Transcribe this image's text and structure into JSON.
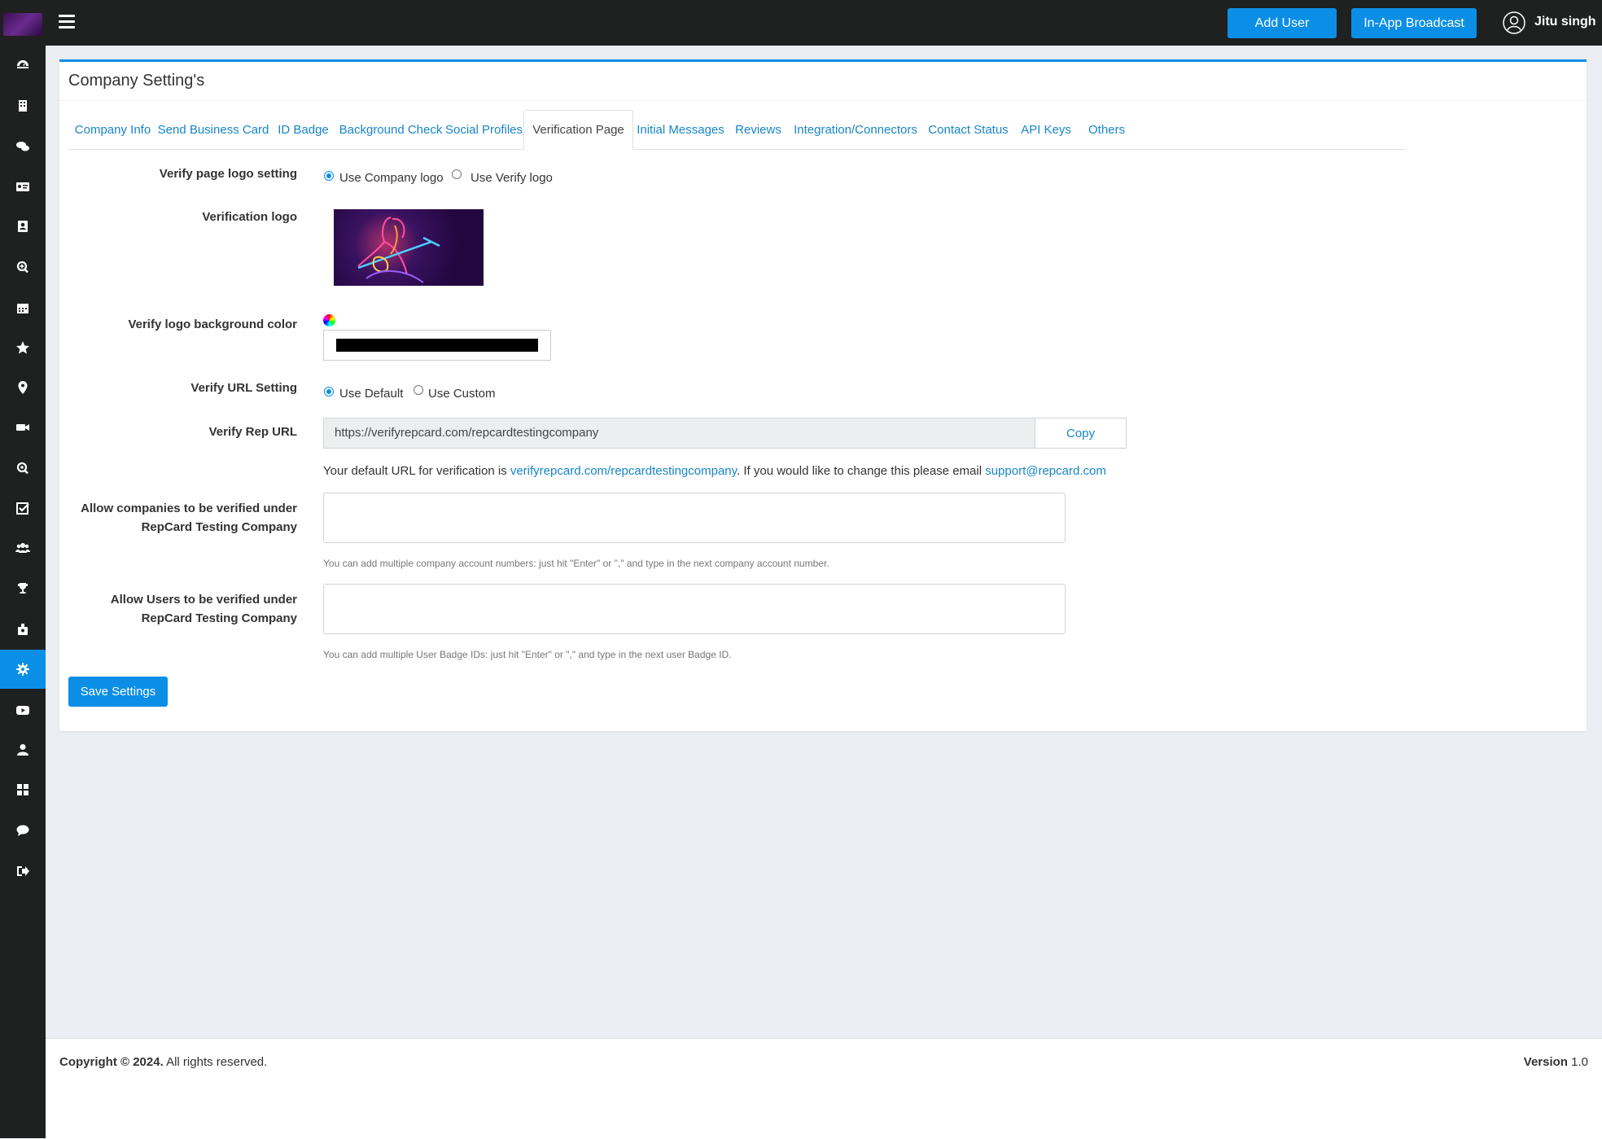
{
  "topbar": {
    "add_user_label": "Add User",
    "broadcast_label": "In-App Broadcast",
    "user_name": "Jitu singh"
  },
  "sidebar": {
    "icons": [
      "dashboard-icon",
      "building-icon",
      "chat-icon",
      "id-card-icon",
      "contact-book-icon",
      "search-plus-icon",
      "calendar-icon",
      "star-icon",
      "location-pin-icon",
      "video-icon",
      "search-icon",
      "checklist-icon",
      "users-icon",
      "trophy-icon",
      "badge-icon",
      "gear-icon",
      "youtube-icon",
      "user-icon",
      "grid-icon",
      "comment-icon",
      "logout-icon"
    ],
    "active": "gear-icon"
  },
  "panel": {
    "title": "Company Setting's",
    "tabs": [
      {
        "label": "Company Info"
      },
      {
        "label": "Send Business Card"
      },
      {
        "label": "ID Badge"
      },
      {
        "label": "Background Check"
      },
      {
        "label": "Social Profiles"
      },
      {
        "label": "Verification Page",
        "active": true
      },
      {
        "label": "Initial Messages"
      },
      {
        "label": "Reviews"
      },
      {
        "label": "Integration/Connectors"
      },
      {
        "label": "Contact Status"
      },
      {
        "label": "API Keys"
      },
      {
        "label": "Others"
      }
    ]
  },
  "form": {
    "logo_setting_label": "Verify page logo setting",
    "logo_option_company": "Use Company logo",
    "logo_option_verify": "Use Verify logo",
    "verification_logo_label": "Verification logo",
    "bg_color_label": "Verify logo background color",
    "bg_color_value": "#000000",
    "url_setting_label": "Verify URL Setting",
    "url_option_default": "Use Default",
    "url_option_custom": "Use Custom",
    "rep_url_label": "Verify Rep URL",
    "rep_url_value": "https://verifyrepcard.com/repcardtestingcompany",
    "copy_label": "Copy",
    "url_help_prefix": "Your default URL for verification is ",
    "url_help_link": "verifyrepcard.com/repcardtestingcompany",
    "url_help_middle": ". If you would like to change this please email ",
    "url_help_email": "support@repcard.com",
    "companies_label_line1": "Allow companies to be verified under",
    "companies_label_line2": "RepCard Testing Company",
    "companies_help": "You can add multiple company account numbers: just hit \"Enter\" or \",\" and type in the next company account number.",
    "users_label_line1": "Allow Users to be verified under",
    "users_label_line2": "RepCard Testing Company",
    "users_help": "You can add multiple User Badge IDs: just hit \"Enter\" or \",\" and type in the next user Badge ID.",
    "save_label": "Save Settings"
  },
  "footer": {
    "copyright_bold": "Copyright © 2024.",
    "copyright_rest": " All rights reserved.",
    "version_bold": "Version",
    "version_value": " 1.0"
  }
}
